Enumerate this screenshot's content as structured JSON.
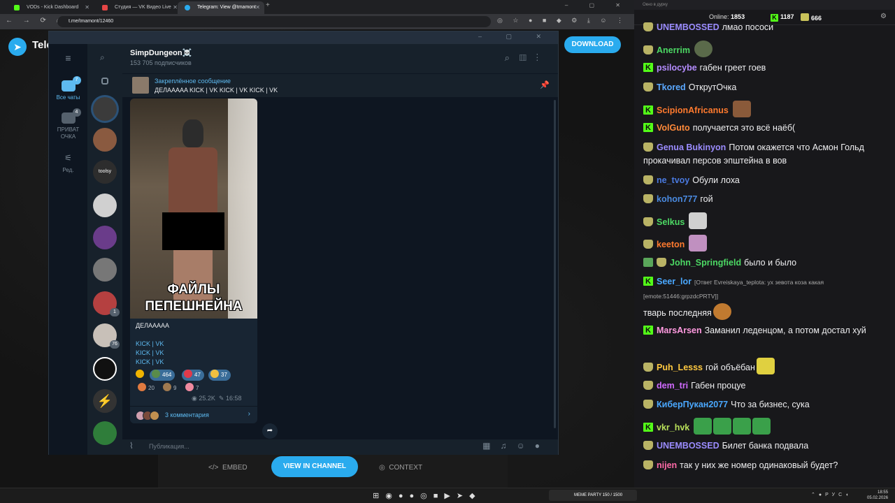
{
  "browser": {
    "tabs": [
      {
        "title": "VODs - Kick Dashboard",
        "favicon_color": "#53fc18"
      },
      {
        "title": "Студия — VK Видео Live",
        "favicon_color": "#e64646"
      },
      {
        "title": "Telegram: View @tmamont",
        "favicon_color": "#2aabee"
      }
    ],
    "url": "t.me/tmamont/12460"
  },
  "tg_page": {
    "brand": "Telegram",
    "download_label": "DOWNLOAD",
    "bottom": {
      "embed": "EMBED",
      "view_channel": "VIEW IN CHANNEL",
      "context": "CONTEXT"
    }
  },
  "tg_window": {
    "folders": [
      {
        "label": "Все чаты",
        "badge": "7"
      },
      {
        "label": "ПРИВАТ ОЧКА",
        "badge": "4"
      },
      {
        "label": "Ред.",
        "badge": ""
      }
    ],
    "chat_avatars": [
      {
        "color": "#3b3b3b",
        "badge": ""
      },
      {
        "color": "#8a5a40",
        "badge": ""
      },
      {
        "color": "#2d2d2d",
        "badge": ""
      },
      {
        "color": "#d0d0d0",
        "badge": ""
      },
      {
        "color": "#6a3c8a",
        "badge": ""
      },
      {
        "color": "#777777",
        "badge": ""
      },
      {
        "color": "#b54040",
        "badge": "1"
      },
      {
        "color": "#c8c0b8",
        "badge": "76"
      },
      {
        "color": "#111111",
        "badge": ""
      },
      {
        "color": "#333333",
        "badge": ""
      },
      {
        "color": "#2f7d3a",
        "badge": ""
      }
    ],
    "avatar_label_3": "toolsy",
    "channel": {
      "title": "SimpDungeon☠️",
      "subscribers": "153 705 подписчиков"
    },
    "pinned": {
      "title": "Закреплённое сообщение",
      "text": "ДЕЛАААAA  KICK | VK KICK | VK KICK | VK"
    },
    "post": {
      "meme_text": "ФАЙЛЫ ПЕПЕШНЕЙНА",
      "text": "ДЕЛААААА",
      "links": [
        "KICK | VK",
        "KICK | VK",
        "KICK | VK"
      ],
      "reactions": [
        {
          "count": "",
          "color": "#f0b400"
        },
        {
          "count": "464",
          "color": "#5a8c4a"
        },
        {
          "count": "47",
          "color": "#e03a4a"
        },
        {
          "count": "37",
          "color": "#f0c040"
        },
        {
          "count": "20",
          "color": "#e07a40"
        },
        {
          "count": "9",
          "color": "#a07a50"
        },
        {
          "count": "7",
          "color": "#f08aa0"
        }
      ],
      "views": "25.2K",
      "time": "16:58",
      "comments": "3 комментария"
    },
    "composer_placeholder": "Публикация..."
  },
  "stream_chat": {
    "window_title": "Окно в дурку",
    "online_label": "Online:",
    "online_count": "1853",
    "kick_count": "1187",
    "vk_count": "666",
    "messages": [
      {
        "platform": "vk",
        "user": "UNEMBOSSED",
        "color": "#9b8cff",
        "text": "лмао пососи"
      },
      {
        "platform": "vk",
        "user": "Anerrim",
        "color": "#4cd964",
        "text": "",
        "emote": "#5a6a4a"
      },
      {
        "platform": "kick",
        "user": "psilocybe",
        "color": "#b48cff",
        "text": "габен греет гоев"
      },
      {
        "platform": "vk",
        "user": "Tkored",
        "color": "#5aa8ff",
        "text": "ОткрутОчка"
      },
      {
        "platform": "kick",
        "user": "ScipionAfricanus",
        "color": "#ff7a2e",
        "text": "",
        "emote": "#8a5a3a"
      },
      {
        "platform": "kick",
        "user": "VolGuto",
        "color": "#ff8a3a",
        "text": "получается это всё наёб("
      },
      {
        "platform": "vk",
        "user": "Genua Bukinyon",
        "color": "#9b8cff",
        "text": "Потом окажется что Асмон Гольд прокачивал персов эпштейна в вов"
      },
      {
        "platform": "vk",
        "user": "ne_tvoy",
        "color": "#4a7ae0",
        "text": "Обули лоха"
      },
      {
        "platform": "vk",
        "user": "kohon777",
        "color": "#4a8ae0",
        "text": "гой"
      },
      {
        "platform": "vk",
        "user": "Selkus",
        "color": "#4cd964",
        "text": "",
        "emote": "#d0d0d0"
      },
      {
        "platform": "vk",
        "user": "keeton",
        "color": "#ff7a2e",
        "text": "",
        "emote": "#c090c0"
      },
      {
        "platform": "vk",
        "user": "John_Springfield",
        "color": "#4cd964",
        "text": "было и было"
      },
      {
        "platform": "kick",
        "user": "Seer_lor",
        "color": "#4aa8ff",
        "text": "тварь последняя",
        "reply": "[Ответ Evreiskaya_teplota: ух зевота коза какая",
        "reply2": "[emote:51446:grpzdcPRTV]]"
      },
      {
        "platform": "kick",
        "user": "MarsArsen",
        "color": "#ff9ae0",
        "text": "Заманил леденцом, а потом достал хуй"
      },
      {
        "platform": "vk",
        "user": "Puh_Lesss",
        "color": "#ffc940",
        "text": "гой объёбан",
        "emote": "#e0d040"
      },
      {
        "platform": "vk",
        "user": "dem_tri",
        "color": "#d06aff",
        "text": "Габен процуе"
      },
      {
        "platform": "vk",
        "user": "КиберПукан2077",
        "color": "#4aa8ff",
        "text": "Что за бизнес, сука"
      },
      {
        "platform": "kick",
        "user": "vkr_hvk",
        "color": "#b9e05a",
        "text": "",
        "emote": "#3aa04a"
      },
      {
        "platform": "vk",
        "user": "UNEMBOSSED",
        "color": "#9b8cff",
        "text": "Билет банка подвала"
      },
      {
        "platform": "vk",
        "user": "nijen",
        "color": "#ff6aa8",
        "text": "так у них же номер одинаковый будет?"
      }
    ]
  },
  "taskbar": {
    "widget": "MEME PARTY 150 / 1500",
    "lang": "РУС",
    "time": "18:55",
    "date": "05.02.2026"
  }
}
